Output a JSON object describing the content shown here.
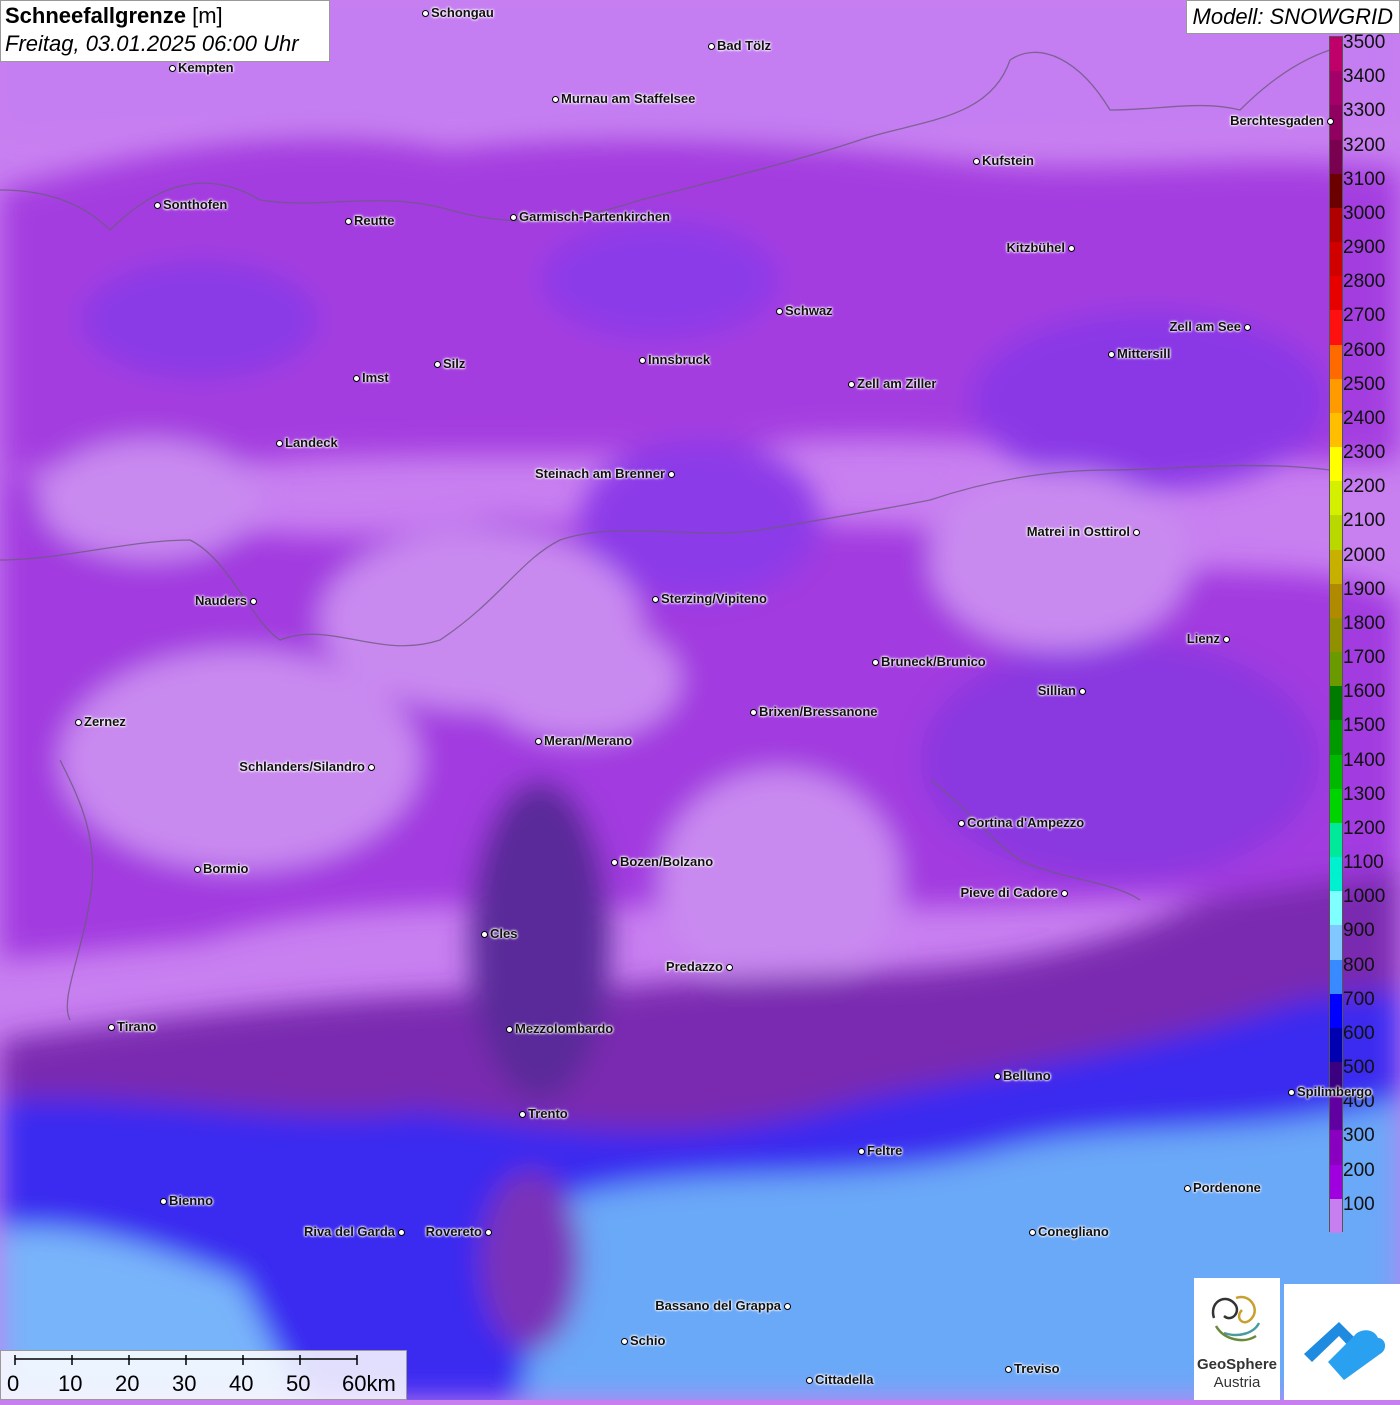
{
  "title": {
    "main_bold": "Schneefallgrenze",
    "unit": "[m]",
    "subtitle": "Freitag, 03.01.2025 06:00 Uhr"
  },
  "model_label": "Modell: SNOWGRID",
  "legend": {
    "labels": [
      "3500",
      "3400",
      "3300",
      "3200",
      "3100",
      "3000",
      "2900",
      "2800",
      "2700",
      "2600",
      "2500",
      "2400",
      "2300",
      "2200",
      "2100",
      "2000",
      "1900",
      "1800",
      "1700",
      "1600",
      "1500",
      "1400",
      "1300",
      "1200",
      "1100",
      "1000",
      "900",
      "800",
      "700",
      "600",
      "500",
      "400",
      "300",
      "200",
      "100"
    ],
    "colors": [
      "#c0006a",
      "#a3006a",
      "#900060",
      "#7a0050",
      "#6a0000",
      "#b00000",
      "#d00000",
      "#e60000",
      "#ff1010",
      "#ff6a00",
      "#ff9a00",
      "#ffbe00",
      "#ffff00",
      "#d4f000",
      "#b8d800",
      "#c8b000",
      "#b08a00",
      "#909000",
      "#6a9a00",
      "#007a00",
      "#009a00",
      "#00b800",
      "#00d400",
      "#00e89a",
      "#00f0d0",
      "#80ffff",
      "#80c8ff",
      "#3a8aff",
      "#0000ff",
      "#0000b0",
      "#3a0080",
      "#6000a0",
      "#8a00c0",
      "#a000e0",
      "#c77ff0"
    ]
  },
  "cities": [
    {
      "name": "Schongau",
      "label_side": "right"
    },
    {
      "name": "Bad Tölz",
      "label_side": "right"
    },
    {
      "name": "Kempten",
      "label_side": "right"
    },
    {
      "name": "Murnau am Staffelsee",
      "label_side": "right"
    },
    {
      "name": "Berchtesgaden",
      "label_side": "left"
    },
    {
      "name": "Kufstein",
      "label_side": "right"
    },
    {
      "name": "Sonthofen",
      "label_side": "right"
    },
    {
      "name": "Reutte",
      "label_side": "right"
    },
    {
      "name": "Garmisch-Partenkirchen",
      "label_side": "right"
    },
    {
      "name": "Kitzbühel",
      "label_side": "left"
    },
    {
      "name": "Schwaz",
      "label_side": "right"
    },
    {
      "name": "Zell am See",
      "label_side": "left"
    },
    {
      "name": "Innsbruck",
      "label_side": "right"
    },
    {
      "name": "Mittersill",
      "label_side": "right"
    },
    {
      "name": "Imst",
      "label_side": "right"
    },
    {
      "name": "Silz",
      "label_side": "right"
    },
    {
      "name": "Zell am Ziller",
      "label_side": "right"
    },
    {
      "name": "Landeck",
      "label_side": "right"
    },
    {
      "name": "Steinach am Brenner",
      "label_side": "left"
    },
    {
      "name": "Matrei in Osttirol",
      "label_side": "left"
    },
    {
      "name": "Nauders",
      "label_side": "left"
    },
    {
      "name": "Sterzing/Vipiteno",
      "label_side": "right"
    },
    {
      "name": "Lienz",
      "label_side": "left"
    },
    {
      "name": "Bruneck/Brunico",
      "label_side": "right"
    },
    {
      "name": "Zernez",
      "label_side": "right"
    },
    {
      "name": "Sillian",
      "label_side": "left"
    },
    {
      "name": "Brixen/Bressanone",
      "label_side": "right"
    },
    {
      "name": "Meran/Merano",
      "label_side": "right"
    },
    {
      "name": "Schlanders/Silandro",
      "label_side": "left"
    },
    {
      "name": "Cortina d'Ampezzo",
      "label_side": "right"
    },
    {
      "name": "Bozen/Bolzano",
      "label_side": "right"
    },
    {
      "name": "Bormio",
      "label_side": "right"
    },
    {
      "name": "Pieve di Cadore",
      "label_side": "left"
    },
    {
      "name": "Cles",
      "label_side": "right"
    },
    {
      "name": "Predazzo",
      "label_side": "left"
    },
    {
      "name": "Tirano",
      "label_side": "right"
    },
    {
      "name": "Mezzolombardo",
      "label_side": "right"
    },
    {
      "name": "Belluno",
      "label_side": "right"
    },
    {
      "name": "Spilimbergo",
      "label_side": "right"
    },
    {
      "name": "Trento",
      "label_side": "right"
    },
    {
      "name": "Feltre",
      "label_side": "right"
    },
    {
      "name": "Pordenone",
      "label_side": "right"
    },
    {
      "name": "Bienno",
      "label_side": "right"
    },
    {
      "name": "Riva del Garda",
      "label_side": "left"
    },
    {
      "name": "Rovereto",
      "label_side": "left"
    },
    {
      "name": "Conegliano",
      "label_side": "right"
    },
    {
      "name": "Bassano del Grappa",
      "label_side": "left"
    },
    {
      "name": "Schio",
      "label_side": "right"
    },
    {
      "name": "Treviso",
      "label_side": "right"
    },
    {
      "name": "Cittadella",
      "label_side": "right"
    }
  ],
  "scalebar": {
    "ticks": [
      "0",
      "10",
      "20",
      "30",
      "40",
      "50",
      "60km"
    ]
  },
  "logos": {
    "geosphere_line1": "GeoSphere",
    "geosphere_line2": "Austria",
    "app_icon": "cloud-arrow-icon"
  }
}
